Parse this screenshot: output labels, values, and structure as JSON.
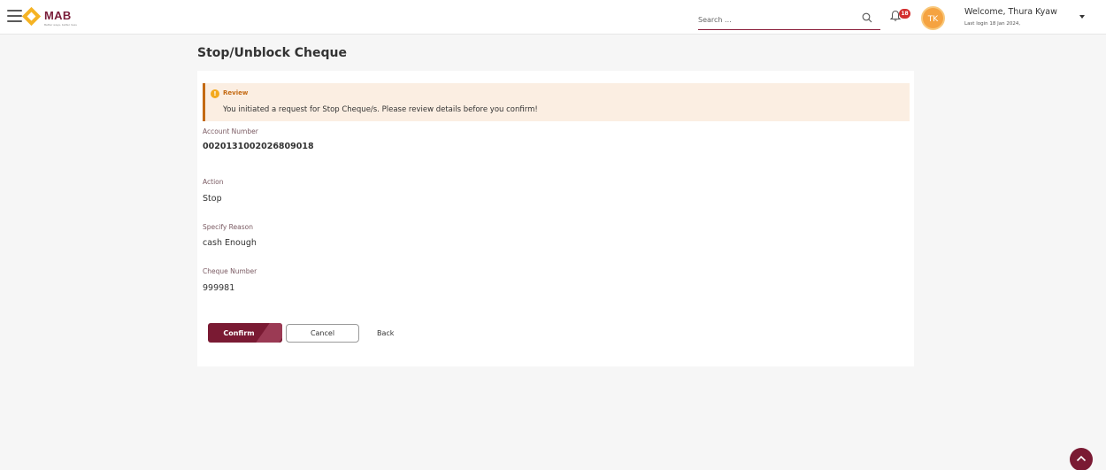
{
  "header": {
    "logo_text": "MAB",
    "logo_tagline": "Better ways, better lives",
    "search_placeholder": "Search ...",
    "notification_count": "18",
    "avatar_initials": "TK",
    "welcome_text": "Welcome, Thura Kyaw",
    "last_login": "Last login 18 Jan 2024,"
  },
  "page": {
    "title": "Stop/Unblock Cheque"
  },
  "review": {
    "icon_glyph": "!",
    "title": "Review",
    "message": "You initiated a request for Stop Cheque/s. Please review details before you confirm!"
  },
  "fields": [
    {
      "label": "Account Number",
      "value": "0020131002026809018"
    },
    {
      "label": "Action",
      "value": "Stop"
    },
    {
      "label": "Specify Reason",
      "value": "cash Enough"
    },
    {
      "label": "Cheque Number",
      "value": "999981"
    }
  ],
  "actions": {
    "confirm": "Confirm",
    "cancel": "Cancel",
    "back": "Back"
  },
  "colors": {
    "brand": "#7a1a33",
    "accent": "#f5b324",
    "review_bg": "#fbeee2",
    "review_border": "#c46a13"
  },
  "icons": [
    "menu-icon",
    "search-icon",
    "bell-icon",
    "info-icon",
    "chevron-up-icon",
    "caret-down-icon"
  ]
}
